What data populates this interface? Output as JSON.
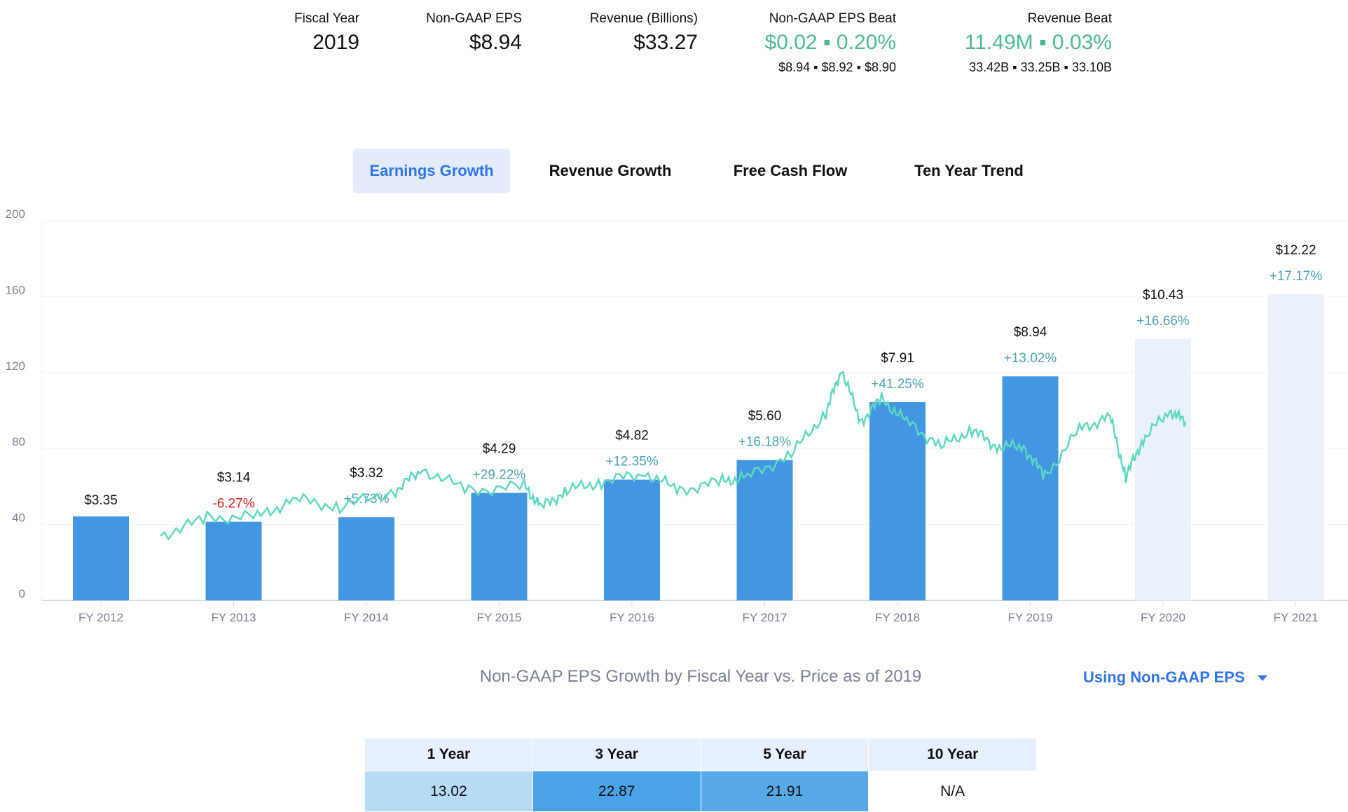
{
  "header": {
    "stats": [
      {
        "label": "Fiscal Year",
        "value": "2019",
        "sub": ""
      },
      {
        "label": "Non-GAAP EPS",
        "value": "$8.94",
        "sub": ""
      },
      {
        "label": "Revenue (Billions)",
        "value": "$33.27",
        "sub": ""
      },
      {
        "label": "Non-GAAP EPS Beat",
        "value": "$0.02 ▪ 0.20%",
        "sub": "$8.94 ▪ $8.92 ▪ $8.90",
        "positive": true
      },
      {
        "label": "Revenue Beat",
        "value": "11.49M ▪ 0.03%",
        "sub": "33.42B ▪ 33.25B ▪ 33.10B",
        "positive": true
      }
    ]
  },
  "tabs": [
    {
      "label": "Earnings Growth",
      "active": true
    },
    {
      "label": "Revenue Growth",
      "active": false
    },
    {
      "label": "Free Cash Flow",
      "active": false
    },
    {
      "label": "Ten Year Trend",
      "active": false
    }
  ],
  "chart_data": {
    "type": "bar",
    "title": "Non-GAAP EPS Growth by Fiscal Year vs. Price as of 2019",
    "categories": [
      "FY 2012",
      "FY 2013",
      "FY 2014",
      "FY 2015",
      "FY 2016",
      "FY 2017",
      "FY 2018",
      "FY 2019",
      "FY 2020",
      "FY 2021"
    ],
    "eps": [
      3.35,
      3.14,
      3.32,
      4.29,
      4.82,
      5.6,
      7.91,
      8.94,
      10.43,
      12.22
    ],
    "eps_labels": [
      "$3.35",
      "$3.14",
      "$3.32",
      "$4.29",
      "$4.82",
      "$5.60",
      "$7.91",
      "$8.94",
      "$10.43",
      "$12.22"
    ],
    "growth_labels": [
      "",
      "-6.27%",
      "+5.73%",
      "+29.22%",
      "+12.35%",
      "+16.18%",
      "+41.25%",
      "+13.02%",
      "+16.66%",
      "+17.17%"
    ],
    "estimate": [
      false,
      false,
      false,
      false,
      false,
      false,
      false,
      false,
      true,
      true
    ],
    "yticks": [
      0,
      40,
      80,
      120,
      160,
      200
    ],
    "ylim": [
      0,
      200
    ],
    "grid": true,
    "price_series": {
      "x": [
        2012.45,
        2012.8,
        2013.18,
        2013.47,
        2013.8,
        2014.22,
        2014.42,
        2014.77,
        2015.19,
        2015.32,
        2015.51,
        2015.77,
        2016.1,
        2016.36,
        2016.68,
        2016.87,
        2017.2,
        2017.46,
        2017.58,
        2017.72,
        2017.88,
        2018.07,
        2018.33,
        2018.56,
        2018.75,
        2018.95,
        2019.11,
        2019.37,
        2019.6,
        2019.72,
        2019.85,
        2020.05,
        2020.17
      ],
      "y": [
        34,
        43.5,
        44,
        53.5,
        49,
        58,
        69,
        58,
        60,
        49,
        58,
        62.6,
        67,
        58,
        62.6,
        65,
        77,
        99,
        122,
        94,
        106,
        94,
        81,
        90,
        81,
        81,
        65,
        90,
        97,
        65,
        85,
        100,
        94
      ]
    },
    "colors": {
      "bar": "#4397e2",
      "bar_estimate": "#eaf1fc",
      "price": "#5fd8c0",
      "growth_pos": "#4aa3b5",
      "growth_neg": "#e02020"
    }
  },
  "dropdown": {
    "label": "Using Non-GAAP EPS"
  },
  "growth_table": {
    "headers": [
      "1 Year",
      "3 Year",
      "5 Year",
      "10 Year"
    ],
    "values": [
      "13.02",
      "22.87",
      "21.91",
      "N/A"
    ],
    "cell_colors": [
      "#b5dbf5",
      "#4aa3e6",
      "#57a9e8",
      "#ffffff"
    ]
  }
}
